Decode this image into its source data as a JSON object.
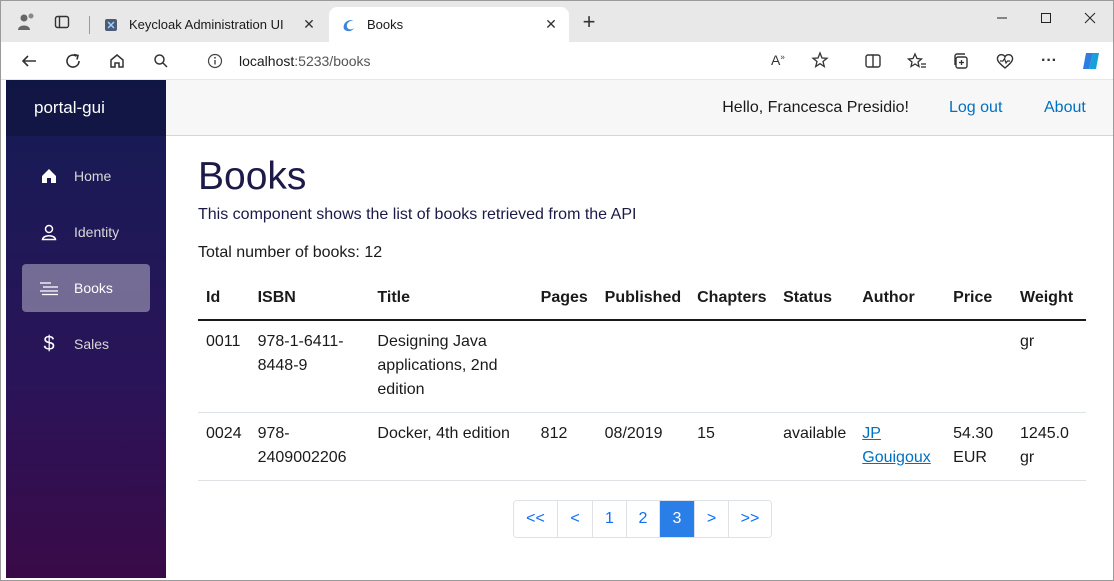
{
  "browser": {
    "tabs": [
      {
        "title": "Keycloak Administration UI"
      },
      {
        "title": "Books"
      }
    ],
    "url_host": "localhost",
    "url_path": ":5233/books"
  },
  "sidebar": {
    "brand": "portal-gui",
    "items": [
      {
        "label": "Home",
        "icon": "home-icon"
      },
      {
        "label": "Identity",
        "icon": "person-icon"
      },
      {
        "label": "Books",
        "icon": "list-icon"
      },
      {
        "label": "Sales",
        "icon": "dollar-icon"
      }
    ]
  },
  "topbar": {
    "greeting": "Hello, Francesca Presidio!",
    "logout": "Log out",
    "about": "About"
  },
  "page": {
    "title": "Books",
    "description": "This component shows the list of books retrieved from the API",
    "total": "Total number of books: 12"
  },
  "table": {
    "headers": [
      "Id",
      "ISBN",
      "Title",
      "Pages",
      "Published",
      "Chapters",
      "Status",
      "Author",
      "Price",
      "Weight"
    ],
    "rows": [
      {
        "id": "0011",
        "isbn": "978-1-6411-8448-9",
        "title": "Designing Java applications, 2nd edition",
        "pages": "",
        "published": "",
        "chapters": "",
        "status": "",
        "author": "",
        "price": "",
        "weight": "gr"
      },
      {
        "id": "0024",
        "isbn": "978-2409002206",
        "title": "Docker, 4th edition",
        "pages": "812",
        "published": "08/2019",
        "chapters": "15",
        "status": "available",
        "author": "JP Gouigoux",
        "price": "54.30 EUR",
        "weight": "1245.0 gr"
      }
    ]
  },
  "pagination": {
    "first": "<<",
    "prev": "<",
    "pages": [
      "1",
      "2",
      "3"
    ],
    "active_page": "3",
    "next": ">",
    "last": ">>"
  },
  "colors": {
    "accent": "#2a7ee8",
    "link": "#0071c1",
    "heading": "#1b1a48"
  }
}
